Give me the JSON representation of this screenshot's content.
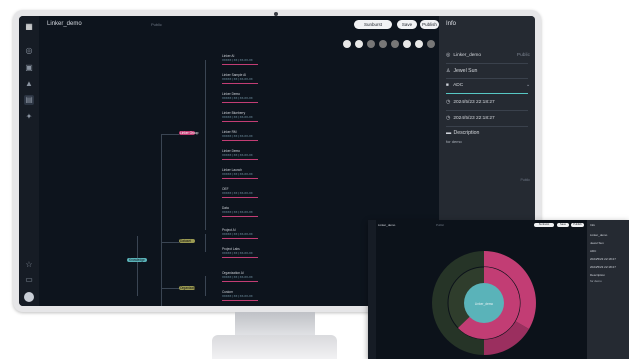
{
  "app": {
    "title": "Linker_demo",
    "subtitle": "Public",
    "buttons": {
      "view": "Sunburst",
      "save": "Save",
      "publish": "Publish"
    }
  },
  "sidebar": {
    "icons": [
      "grid-icon",
      "globe-icon",
      "layers-icon",
      "shapes-icon",
      "document-icon",
      "lightbulb-icon",
      "star-icon",
      "folder-icon",
      "avatar"
    ]
  },
  "info": {
    "heading": "Info",
    "name": "Linker_demo",
    "name_suffix": "Public",
    "owner": "Jewel Sun",
    "group": "ADC",
    "created": "2024/5/23 22:18:27",
    "updated": "2024/5/23 22:18:27",
    "description_label": "Description",
    "description": "for demo",
    "footer": "Public"
  },
  "tree": {
    "root": "Knowledge",
    "branches": [
      "Linker Group",
      "Dataset",
      "Organization"
    ],
    "leaves": [
      "Linker AI",
      "Linker Sample AI",
      "Linker Demo",
      "Linker Blueberry",
      "Linker RM",
      "Linker Demo",
      "Linker Launch",
      "OEF",
      "Data",
      "Project AI",
      "Project Labs",
      "Organization AI",
      "Custom"
    ],
    "leaf_meta": "XXXXX | XX | XX-XX-XX"
  },
  "window2": {
    "title": "Linker_demo",
    "subtitle": "Public",
    "buttons": [
      "Sunburst",
      "Save",
      "Publish"
    ],
    "center_label": "Linker_demo",
    "panel": {
      "heading": "Info",
      "name": "Linker_demo",
      "owner": "Jewel Sun",
      "group": "ADC",
      "created": "2024/5/23 22:18:27",
      "updated": "2024/5/23 22:18:27",
      "description_label": "Description",
      "description": "for demo"
    }
  },
  "colors": {
    "accent": "#57c7c4",
    "pink": "#c23d74",
    "olive": "#9a9a52",
    "teal": "#5ab3b9"
  }
}
